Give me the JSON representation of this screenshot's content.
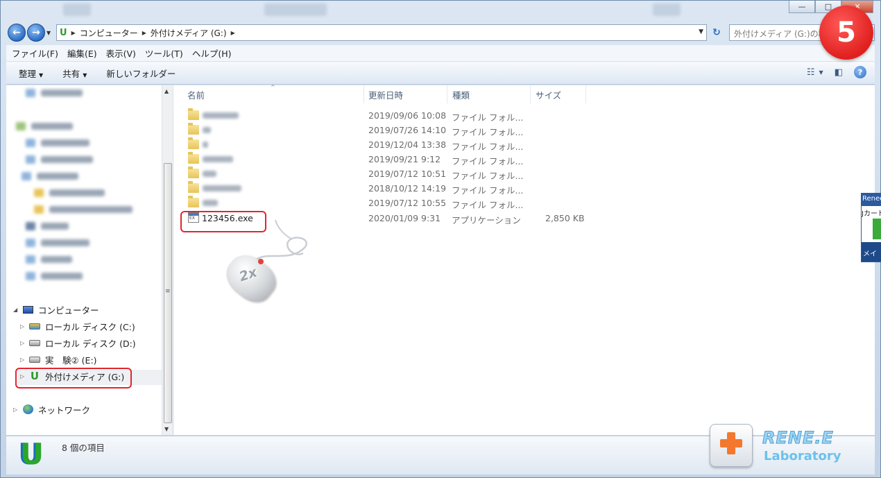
{
  "window": {
    "controls": {
      "minimize": "—",
      "maximize": "□",
      "close": "✕"
    }
  },
  "address": {
    "back_icon": "back-arrow-icon",
    "forward_icon": "forward-arrow-icon",
    "crumbs": [
      "コンピューター",
      "外付けメディア (G:)"
    ],
    "search_placeholder": "外付けメディア (G:)の検索"
  },
  "menu": [
    "ファイル(F)",
    "編集(E)",
    "表示(V)",
    "ツール(T)",
    "ヘルプ(H)"
  ],
  "toolbar": {
    "organize": "整理",
    "share": "共有",
    "new_folder": "新しいフォルダー"
  },
  "tree": {
    "computer": "コンピューター",
    "drive_c": "ローカル ディスク (C:)",
    "drive_d": "ローカル ディスク (D:)",
    "drive_e": "実　験② (E:)",
    "drive_g": "外付けメディア (G:)",
    "network": "ネットワーク"
  },
  "columns": {
    "name": "名前",
    "modified": "更新日時",
    "type": "種類",
    "size": "サイズ"
  },
  "files": [
    {
      "date": "2019/09/06 10:08",
      "type": "ファイル フォル...",
      "size": ""
    },
    {
      "date": "2019/07/26 14:10",
      "type": "ファイル フォル...",
      "size": ""
    },
    {
      "date": "2019/12/04 13:38",
      "type": "ファイル フォル...",
      "size": ""
    },
    {
      "date": "2019/09/21 9:12",
      "type": "ファイル フォル...",
      "size": ""
    },
    {
      "date": "2019/07/12 10:51",
      "type": "ファイル フォル...",
      "size": ""
    },
    {
      "date": "2018/10/12 14:19",
      "type": "ファイル フォル...",
      "size": ""
    },
    {
      "date": "2019/07/12 10:55",
      "type": "ファイル フォル...",
      "size": ""
    }
  ],
  "exe": {
    "name": "123456.exe",
    "date": "2020/01/09 9:31",
    "type": "アプリケーション",
    "size": "2,850 KB"
  },
  "overlay": {
    "step_number": "5",
    "mouse_label": "2x"
  },
  "popup": {
    "header": "Renee",
    "text": "Jカード",
    "button": "メイ"
  },
  "status": {
    "item_count": "8 個の項目"
  },
  "logo": {
    "brand": "RENE.E",
    "sub": "Laboratory"
  },
  "colors": {
    "highlight_red": "#e0262e",
    "accent_blue": "#2d6fc4",
    "folder_yellow": "#e8c45a"
  }
}
